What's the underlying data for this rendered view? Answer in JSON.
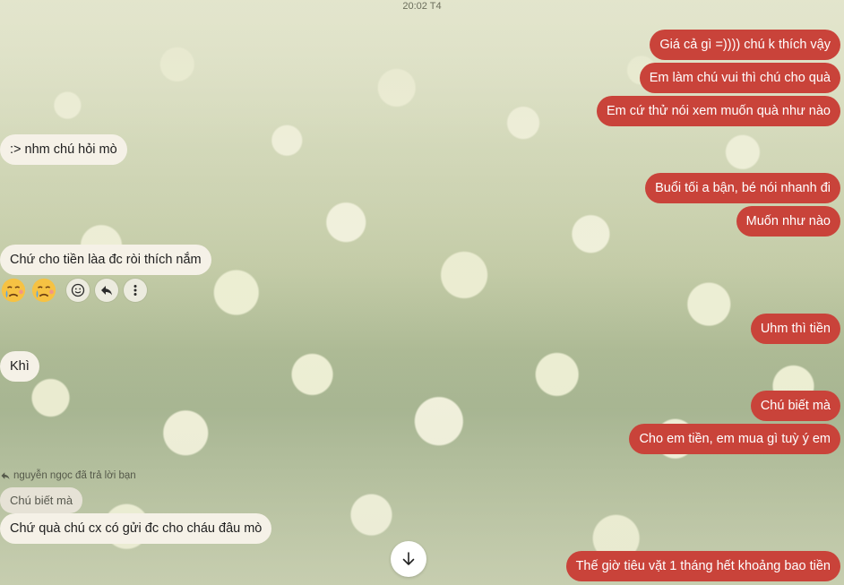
{
  "header": {
    "time": "20:02 T4"
  },
  "messages": {
    "m1": "Giá cả gì =)))) chú k thích vậy",
    "m2": "Em làm chú vui thì chú cho quà",
    "m3": "Em cứ thử nói xem muốn quà như nào",
    "m4": ":> nhm chú hỏi mò",
    "m5": "Buổi tối a bận, bé nói nhanh đi",
    "m6": "Muốn như nào",
    "m7": "Chứ cho tiền làa đc ròi thích nắm",
    "m8": "Uhm thì tiền",
    "m9": "Khì",
    "m10": "Chú biết mà",
    "m11": "Cho em tiền, em mua gì tuỳ ý em",
    "m12": "Chứ quà chú cx có gửi đc cho cháu đâu mò",
    "m13": "Thế giờ tiêu vặt 1 tháng hết khoảng bao tiền"
  },
  "reply": {
    "note": "nguyễn ngọc đã trả lời bạn",
    "quoted": "Chú biết mà"
  },
  "reactions": [
    "crying-face",
    "crying-face"
  ],
  "actions": [
    "smiley-icon",
    "reply-icon",
    "more-icon"
  ],
  "colors": {
    "outgoing": "#c9433a",
    "incoming": "#f5f1e7"
  }
}
